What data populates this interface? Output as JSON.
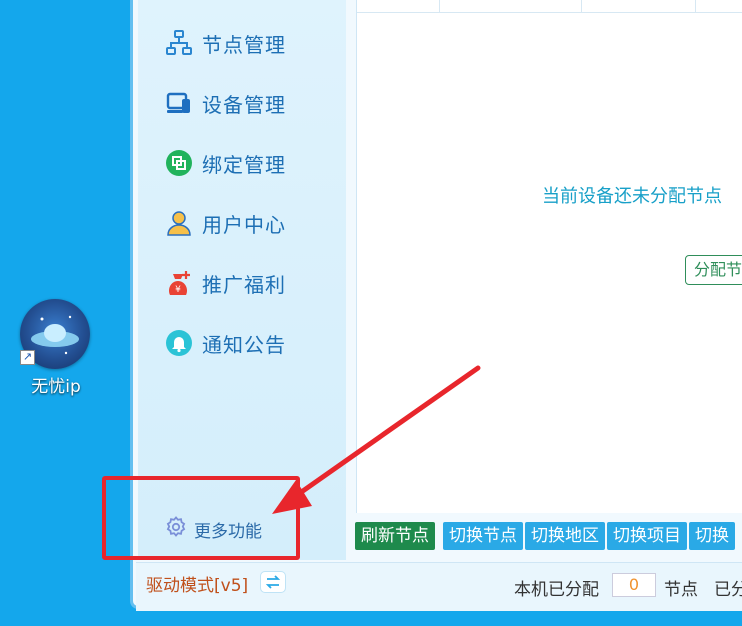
{
  "desktop": {
    "shortcut_label": "无忧ip"
  },
  "sidebar": {
    "items": [
      {
        "label": "节点管理",
        "icon": "sitemap-icon"
      },
      {
        "label": "设备管理",
        "icon": "device-icon"
      },
      {
        "label": "绑定管理",
        "icon": "bind-icon"
      },
      {
        "label": "用户中心",
        "icon": "user-icon"
      },
      {
        "label": "推广福利",
        "icon": "money-bag-icon"
      },
      {
        "label": "通知公告",
        "icon": "bell-icon"
      }
    ],
    "more_label": "更多功能",
    "more_icon": "gear-icon"
  },
  "main": {
    "empty_message": "当前设备还未分配节点",
    "assign_button_label": "分配节"
  },
  "toolbar": {
    "refresh_label": "刷新节点",
    "switch_node_label": "切换节点",
    "switch_region_label": "切换地区",
    "switch_project_label": "切换项目",
    "switch_more_label": "切换"
  },
  "status": {
    "drive_mode": "驱动模式[v5]",
    "assigned_label": "本机已分配",
    "assigned_count": "0",
    "node_unit": "节点",
    "allocated_label": "已分"
  },
  "colors": {
    "desktop_bg": "#14a7ec",
    "accent_blue": "#2aa9e6",
    "accent_green": "#1e8a4c",
    "highlight_red": "#e8262c",
    "drive_mode_orange": "#c0501b"
  }
}
